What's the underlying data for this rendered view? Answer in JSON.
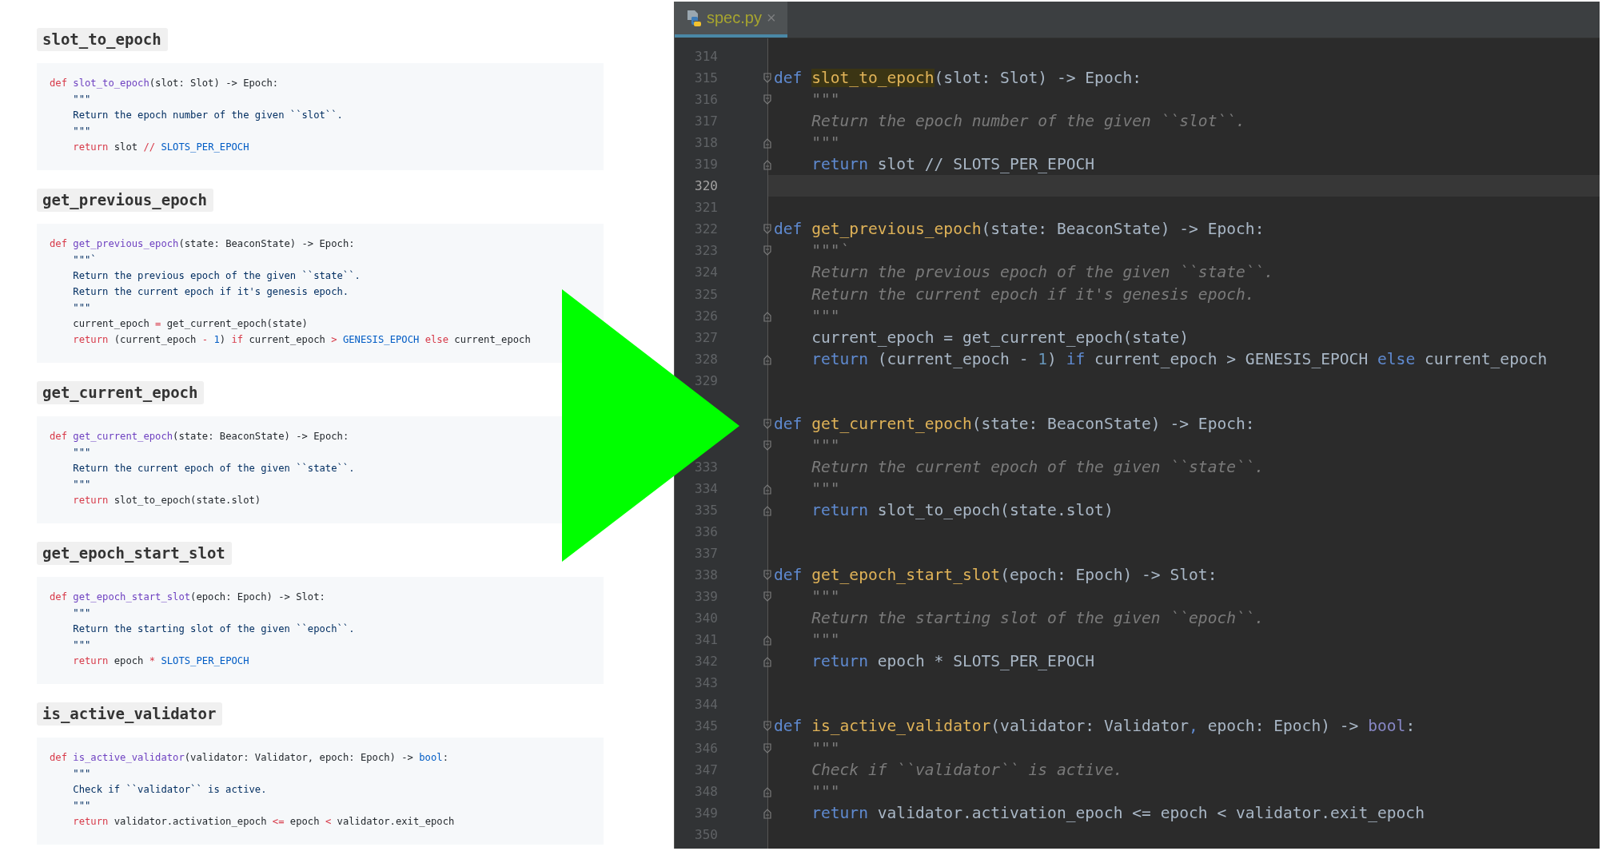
{
  "doc": {
    "sections": [
      {
        "heading": "slot_to_epoch",
        "code": [
          [
            {
              "kind": "kw",
              "text": "def "
            },
            {
              "kind": "fn",
              "text": "slot_to_epoch"
            },
            {
              "kind": "plain",
              "text": "(slot: Slot) -> Epoch:"
            }
          ],
          [
            {
              "kind": "doc",
              "text": "    \"\"\""
            }
          ],
          [
            {
              "kind": "doc",
              "text": "    Return the epoch number of the given ``slot``."
            }
          ],
          [
            {
              "kind": "doc",
              "text": "    \"\"\""
            }
          ],
          [
            {
              "kind": "kw",
              "text": "    return"
            },
            {
              "kind": "plain",
              "text": " slot "
            },
            {
              "kind": "op",
              "text": "//"
            },
            {
              "kind": "const",
              "text": " SLOTS_PER_EPOCH"
            }
          ]
        ]
      },
      {
        "heading": "get_previous_epoch",
        "code": [
          [
            {
              "kind": "kw",
              "text": "def "
            },
            {
              "kind": "fn",
              "text": "get_previous_epoch"
            },
            {
              "kind": "plain",
              "text": "(state: BeaconState) -> Epoch:"
            }
          ],
          [
            {
              "kind": "doc",
              "text": "    \"\"\"`"
            }
          ],
          [
            {
              "kind": "doc",
              "text": "    Return the previous epoch of the given ``state``."
            }
          ],
          [
            {
              "kind": "doc",
              "text": "    Return the current epoch if it's genesis epoch."
            }
          ],
          [
            {
              "kind": "doc",
              "text": "    \"\"\""
            }
          ],
          [
            {
              "kind": "plain",
              "text": "    current_epoch "
            },
            {
              "kind": "op",
              "text": "="
            },
            {
              "kind": "plain",
              "text": " get_current_epoch(state)"
            }
          ],
          [
            {
              "kind": "kw",
              "text": "    return"
            },
            {
              "kind": "plain",
              "text": " (current_epoch "
            },
            {
              "kind": "op",
              "text": "-"
            },
            {
              "kind": "num",
              "text": " 1"
            },
            {
              "kind": "plain",
              "text": ") "
            },
            {
              "kind": "kw",
              "text": "if"
            },
            {
              "kind": "plain",
              "text": " current_epoch "
            },
            {
              "kind": "op",
              "text": ">"
            },
            {
              "kind": "const",
              "text": " GENESIS_EPOCH"
            },
            {
              "kind": "kw",
              "text": " else"
            },
            {
              "kind": "plain",
              "text": " current_epoch"
            }
          ]
        ]
      },
      {
        "heading": "get_current_epoch",
        "code": [
          [
            {
              "kind": "kw",
              "text": "def "
            },
            {
              "kind": "fn",
              "text": "get_current_epoch"
            },
            {
              "kind": "plain",
              "text": "(state: BeaconState) -> Epoch:"
            }
          ],
          [
            {
              "kind": "doc",
              "text": "    \"\"\""
            }
          ],
          [
            {
              "kind": "doc",
              "text": "    Return the current epoch of the given ``state``."
            }
          ],
          [
            {
              "kind": "doc",
              "text": "    \"\"\""
            }
          ],
          [
            {
              "kind": "kw",
              "text": "    return"
            },
            {
              "kind": "plain",
              "text": " slot_to_epoch(state.slot)"
            }
          ]
        ]
      },
      {
        "heading": "get_epoch_start_slot",
        "code": [
          [
            {
              "kind": "kw",
              "text": "def "
            },
            {
              "kind": "fn",
              "text": "get_epoch_start_slot"
            },
            {
              "kind": "plain",
              "text": "(epoch: Epoch) -> Slot:"
            }
          ],
          [
            {
              "kind": "doc",
              "text": "    \"\"\""
            }
          ],
          [
            {
              "kind": "doc",
              "text": "    Return the starting slot of the given ``epoch``."
            }
          ],
          [
            {
              "kind": "doc",
              "text": "    \"\"\""
            }
          ],
          [
            {
              "kind": "kw",
              "text": "    return"
            },
            {
              "kind": "plain",
              "text": " epoch "
            },
            {
              "kind": "op",
              "text": "*"
            },
            {
              "kind": "const",
              "text": " SLOTS_PER_EPOCH"
            }
          ]
        ]
      },
      {
        "heading": "is_active_validator",
        "code": [
          [
            {
              "kind": "kw",
              "text": "def "
            },
            {
              "kind": "fn",
              "text": "is_active_validator"
            },
            {
              "kind": "plain",
              "text": "(validator: Validator, epoch: Epoch) -> "
            },
            {
              "kind": "builtin",
              "text": "bool"
            },
            {
              "kind": "plain",
              "text": ":"
            }
          ],
          [
            {
              "kind": "doc",
              "text": "    \"\"\""
            }
          ],
          [
            {
              "kind": "doc",
              "text": "    Check if ``validator`` is active."
            }
          ],
          [
            {
              "kind": "doc",
              "text": "    \"\"\""
            }
          ],
          [
            {
              "kind": "kw",
              "text": "    return"
            },
            {
              "kind": "plain",
              "text": " validator.activation_epoch "
            },
            {
              "kind": "op",
              "text": "<="
            },
            {
              "kind": "plain",
              "text": " epoch "
            },
            {
              "kind": "op",
              "text": "<"
            },
            {
              "kind": "plain",
              "text": " validator.exit_epoch"
            }
          ]
        ]
      }
    ]
  },
  "editor": {
    "tabs": [
      {
        "label": "spec.py",
        "close": "×",
        "selected": true
      }
    ],
    "lines": [
      {
        "n": "314",
        "current": false
      },
      {
        "n": "315",
        "current": false,
        "kind": "fold_start",
        "code": [
          {
            "kind": "kw",
            "text": "def "
          },
          {
            "kind": "fn_marked",
            "text": "slot_to_epoch"
          },
          {
            "kind": "plain",
            "text": "(slot: Slot) -> Epoch:"
          }
        ]
      },
      {
        "n": "316",
        "current": false,
        "kind": "fold_start",
        "code": [
          {
            "kind": "doc",
            "text": "    \"\"\""
          }
        ]
      },
      {
        "n": "317",
        "current": false,
        "code": [
          {
            "kind": "doc",
            "text": "    Return the epoch number of the given ``slot``."
          }
        ]
      },
      {
        "n": "318",
        "current": false,
        "kind": "fold_end",
        "code": [
          {
            "kind": "doc",
            "text": "    \"\"\""
          }
        ]
      },
      {
        "n": "319",
        "current": false,
        "kind": "fold_end",
        "code": [
          {
            "kind": "kw",
            "text": "    return"
          },
          {
            "kind": "plain",
            "text": " slot // SLOTS_PER_EPOCH"
          }
        ]
      },
      {
        "n": "320",
        "current": true
      },
      {
        "n": "321",
        "current": false
      },
      {
        "n": "322",
        "current": false,
        "kind": "fold_start",
        "code": [
          {
            "kind": "kw",
            "text": "def "
          },
          {
            "kind": "fn",
            "text": "get_previous_epoch"
          },
          {
            "kind": "plain",
            "text": "(state: BeaconState) -> Epoch:"
          }
        ]
      },
      {
        "n": "323",
        "current": false,
        "kind": "fold_start",
        "code": [
          {
            "kind": "doc",
            "text": "    \"\"\"`"
          }
        ]
      },
      {
        "n": "324",
        "current": false,
        "code": [
          {
            "kind": "doc",
            "text": "    Return the previous epoch of the given ``state``."
          }
        ]
      },
      {
        "n": "325",
        "current": false,
        "code": [
          {
            "kind": "doc",
            "text": "    Return the current epoch if it's genesis epoch."
          }
        ]
      },
      {
        "n": "326",
        "current": false,
        "kind": "fold_end",
        "code": [
          {
            "kind": "doc",
            "text": "    \"\"\""
          }
        ]
      },
      {
        "n": "327",
        "current": false,
        "code": [
          {
            "kind": "plain",
            "text": "    current_epoch = get_current_epoch(state)"
          }
        ]
      },
      {
        "n": "328",
        "current": false,
        "kind": "fold_end",
        "code": [
          {
            "kind": "kw",
            "text": "    return"
          },
          {
            "kind": "plain",
            "text": " (current_epoch - "
          },
          {
            "kind": "num",
            "text": "1"
          },
          {
            "kind": "plain",
            "text": ") "
          },
          {
            "kind": "kw",
            "text": "if"
          },
          {
            "kind": "plain",
            "text": " current_epoch > GENESIS_EPOCH "
          },
          {
            "kind": "kw",
            "text": "else"
          },
          {
            "kind": "plain",
            "text": " current_epoch"
          }
        ]
      },
      {
        "n": "329",
        "current": false
      },
      {
        "current": false
      },
      {
        "current": false,
        "kind": "fold_start",
        "code": [
          {
            "kind": "kw",
            "text": "def "
          },
          {
            "kind": "fn",
            "text": "get_current_epoch"
          },
          {
            "kind": "plain",
            "text": "(state: BeaconState) -> Epoch:"
          }
        ]
      },
      {
        "current": false,
        "kind": "fold_start",
        "code": [
          {
            "kind": "doc",
            "text": "    \"\"\""
          }
        ]
      },
      {
        "n": "333",
        "current": false,
        "code": [
          {
            "kind": "doc",
            "text": "    Return the current epoch of the given ``state``."
          }
        ]
      },
      {
        "n": "334",
        "current": false,
        "kind": "fold_end",
        "code": [
          {
            "kind": "doc",
            "text": "    \"\"\""
          }
        ]
      },
      {
        "n": "335",
        "current": false,
        "kind": "fold_end",
        "code": [
          {
            "kind": "kw",
            "text": "    return"
          },
          {
            "kind": "plain",
            "text": " slot_to_epoch(state.slot)"
          }
        ]
      },
      {
        "n": "336",
        "current": false
      },
      {
        "n": "337",
        "current": false
      },
      {
        "n": "338",
        "current": false,
        "kind": "fold_start",
        "code": [
          {
            "kind": "kw",
            "text": "def "
          },
          {
            "kind": "fn",
            "text": "get_epoch_start_slot"
          },
          {
            "kind": "plain",
            "text": "(epoch: Epoch) -> Slot:"
          }
        ]
      },
      {
        "n": "339",
        "current": false,
        "kind": "fold_start",
        "code": [
          {
            "kind": "doc",
            "text": "    \"\"\""
          }
        ]
      },
      {
        "n": "340",
        "current": false,
        "code": [
          {
            "kind": "doc",
            "text": "    Return the starting slot of the given ``epoch``."
          }
        ]
      },
      {
        "n": "341",
        "current": false,
        "kind": "fold_end",
        "code": [
          {
            "kind": "doc",
            "text": "    \"\"\""
          }
        ]
      },
      {
        "n": "342",
        "current": false,
        "kind": "fold_end",
        "code": [
          {
            "kind": "kw",
            "text": "    return"
          },
          {
            "kind": "plain",
            "text": " epoch * SLOTS_PER_EPOCH"
          }
        ]
      },
      {
        "n": "343",
        "current": false
      },
      {
        "n": "344",
        "current": false
      },
      {
        "n": "345",
        "current": false,
        "kind": "fold_start",
        "code": [
          {
            "kind": "kw",
            "text": "def "
          },
          {
            "kind": "fn",
            "text": "is_active_validator"
          },
          {
            "kind": "plain",
            "text": "(validator: Validator"
          },
          {
            "kind": "comma",
            "text": ","
          },
          {
            "kind": "plain",
            "text": " epoch: Epoch) -> "
          },
          {
            "kind": "builtin",
            "text": "bool"
          },
          {
            "kind": "plain",
            "text": ":"
          }
        ]
      },
      {
        "n": "346",
        "current": false,
        "kind": "fold_start",
        "code": [
          {
            "kind": "doc",
            "text": "    \"\"\""
          }
        ]
      },
      {
        "n": "347",
        "current": false,
        "code": [
          {
            "kind": "doc",
            "text": "    Check if ``validator`` is active."
          }
        ]
      },
      {
        "n": "348",
        "current": false,
        "kind": "fold_end",
        "code": [
          {
            "kind": "doc",
            "text": "    \"\"\""
          }
        ]
      },
      {
        "n": "349",
        "current": false,
        "kind": "fold_end",
        "code": [
          {
            "kind": "kw",
            "text": "    return"
          },
          {
            "kind": "plain",
            "text": " validator.activation_epoch <= epoch < validator.exit_epoch"
          }
        ]
      },
      {
        "n": "350",
        "current": false
      }
    ]
  }
}
